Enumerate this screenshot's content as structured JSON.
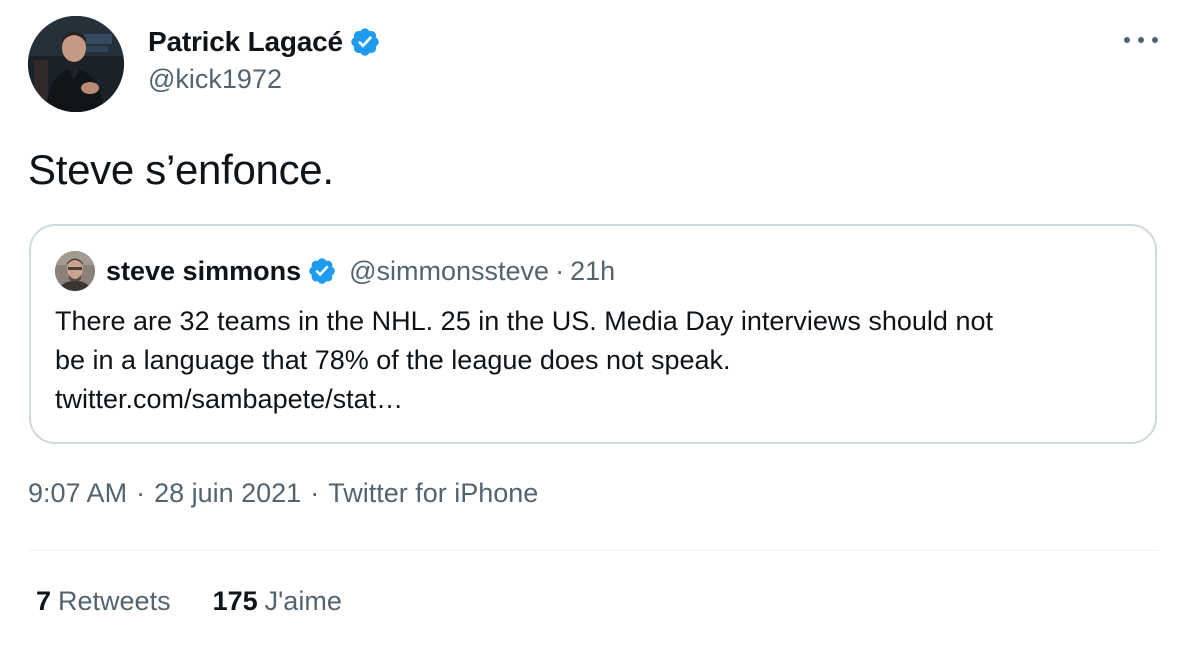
{
  "author": {
    "display_name": "Patrick Lagacé",
    "handle": "@kick1972",
    "verified": true
  },
  "tweet": {
    "text": "Steve s’enfonce."
  },
  "quote": {
    "display_name": "steve simmons",
    "handle": "@simmonssteve",
    "separator": "·",
    "time": "21h",
    "verified": true,
    "lines": [
      "There are 32 teams in the NHL. 25 in the US. Media Day interviews should not",
      "be in a language that 78% of the league does not speak.",
      "twitter.com/sambapete/stat…"
    ]
  },
  "meta": {
    "time": "9:07 AM",
    "separator": "·",
    "date": "28 juin 2021",
    "source": "Twitter for iPhone"
  },
  "stats": {
    "retweets_count": "7",
    "retweets_label": "Retweets",
    "likes_count": "175",
    "likes_label": "J'aime"
  },
  "icons": {
    "verified": "verified-badge-icon",
    "more": "more-horizontal-icon"
  },
  "colors": {
    "verified_blue": "#1d9bf0",
    "secondary_text": "#536471",
    "primary_text": "#0f1419",
    "border": "#cfd9de"
  }
}
